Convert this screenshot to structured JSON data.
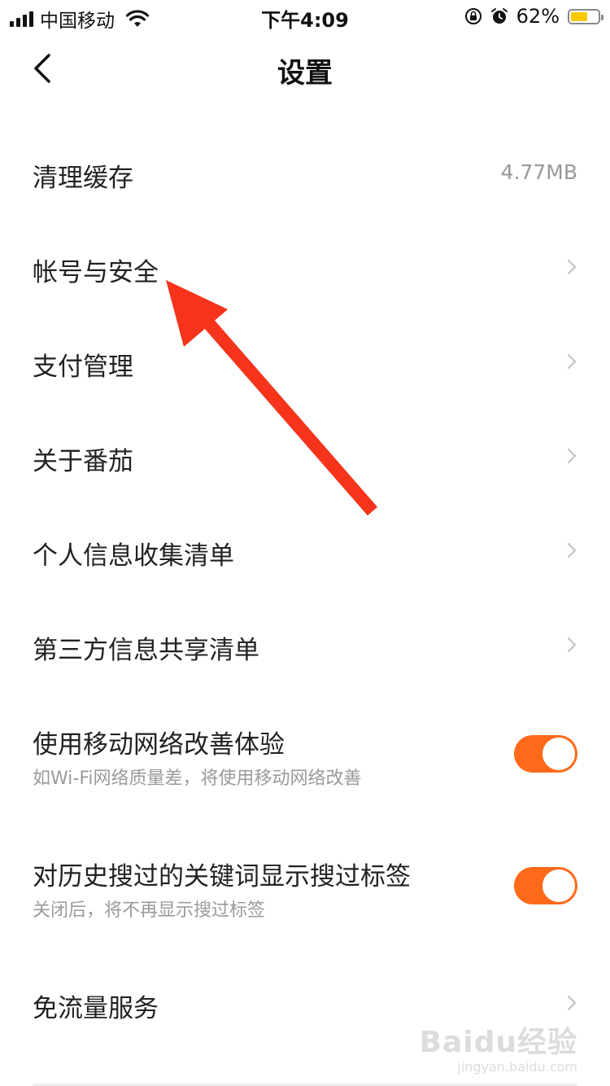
{
  "status_bar": {
    "carrier": "中国移动",
    "time": "下午4:09",
    "battery_text": "62%",
    "battery_level": 0.62,
    "battery_color": "#f7c800",
    "icons": [
      "signal-icon",
      "wifi-icon",
      "orientation-lock-icon",
      "alarm-icon",
      "battery-icon"
    ]
  },
  "nav": {
    "title": "设置",
    "back_icon": "chevron-left-icon"
  },
  "settings": {
    "clear_cache": {
      "label": "清理缓存",
      "value": "4.77MB"
    },
    "account_security": {
      "label": "帐号与安全"
    },
    "payment": {
      "label": "支付管理"
    },
    "about": {
      "label": "关于番茄"
    },
    "personal_info": {
      "label": "个人信息收集清单"
    },
    "third_party": {
      "label": "第三方信息共享清单"
    },
    "mobile_network": {
      "label": "使用移动网络改善体验",
      "sub": "如Wi-Fi网络质量差，将使用移动网络改善",
      "enabled": true
    },
    "search_tags": {
      "label": "对历史搜过的关键词显示搜过标签",
      "sub": "关闭后，将不再显示搜过标签",
      "enabled": true
    },
    "free_data": {
      "label": "免流量服务"
    }
  },
  "colors": {
    "accent": "#ff6a1a",
    "annotation_arrow": "#f5341b"
  },
  "watermark": {
    "logo": "Baidu经验",
    "url": "jingyan.baidu.com"
  }
}
